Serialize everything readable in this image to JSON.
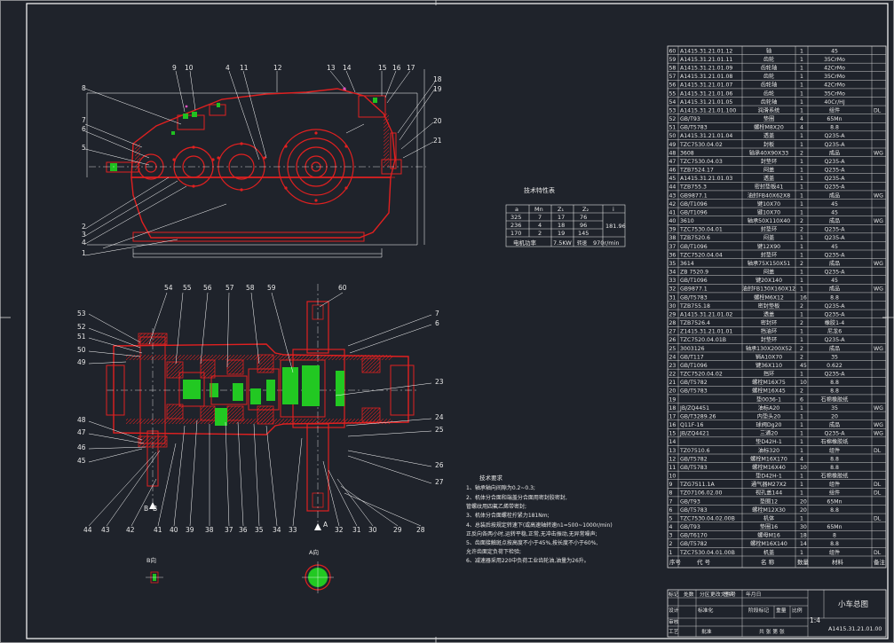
{
  "drawing": {
    "title": "小车总图",
    "number": "A1415.31.21.01.00",
    "scale": "1:4",
    "params_title": "技术特性表",
    "params_headers": [
      "a",
      "Mn",
      "Z₁",
      "Z₂",
      "i"
    ],
    "params_rows": [
      [
        "325",
        "7",
        "17",
        "76"
      ],
      [
        "236",
        "4",
        "18",
        "96"
      ],
      [
        "170",
        "2",
        "19",
        "145"
      ]
    ],
    "params_i": "181.96",
    "motor_power_label": "电机功率",
    "motor_power": "7.5KW",
    "speed_label": "转速",
    "speed": "970r/min",
    "tech_title": "技术要求",
    "tech_notes": [
      "1、轴承轴向间隙为0.2~0.3;",
      "2、机体分合面和端盖分合面用密封胶密封,",
      "   管螺纹用四氟乙烯带密封;",
      "3、机体分合面螺栓拧紧力181Nm;",
      "4、总装后按规定转速下(或高速轴转速n1=500~1000r/min)",
      "   正反向各两小时,运转平稳,正常,无冲击振动,无异常噪声;",
      "5、齿面接触斑点按高度不小于45%,按长度不小于60%,",
      "   允许齿面定负荷下检验;",
      "6、减速器采用220中负荷工业齿轮油,油量为26升。"
    ],
    "view_b": "B向",
    "view_a": "A向",
    "label_a": "A",
    "label_b": "B",
    "top_leaders": [
      "1",
      "2",
      "3",
      "4",
      "5",
      "6",
      "7",
      "8",
      "9",
      "10",
      "4",
      "11",
      "12",
      "13",
      "14",
      "15",
      "16",
      "17",
      "18",
      "19",
      "20",
      "21"
    ],
    "bottom_leaders": [
      "54",
      "55",
      "56",
      "57",
      "58",
      "59",
      "60",
      "53",
      "52",
      "51",
      "50",
      "49",
      "48",
      "47",
      "46",
      "45",
      "7",
      "6",
      "23",
      "24",
      "25",
      "26",
      "27",
      "44",
      "43",
      "42",
      "41",
      "40",
      "39",
      "38",
      "37",
      "36",
      "35",
      "34",
      "33",
      "32",
      "31",
      "30",
      "29",
      "28"
    ]
  },
  "bom": {
    "header": [
      "序号",
      "代 号",
      "名 称",
      "数量",
      "材料",
      "备注"
    ],
    "rows": [
      [
        "60",
        "A1415.31.21.01.12",
        "轴",
        "1",
        "45",
        ""
      ],
      [
        "59",
        "A1415.31.21.01.11",
        "齿轮",
        "1",
        "35CrMo",
        ""
      ],
      [
        "58",
        "A1415.31.21.01.09",
        "齿轮轴",
        "1",
        "42CrMo",
        ""
      ],
      [
        "57",
        "A1415.31.21.01.08",
        "齿轮",
        "1",
        "35CrMo",
        ""
      ],
      [
        "56",
        "A1415.31.21.01.07",
        "齿轮轴",
        "1",
        "42CrMo",
        ""
      ],
      [
        "55",
        "A1415.31.21.01.06",
        "齿轮",
        "1",
        "35CrMo",
        ""
      ],
      [
        "54",
        "A1415.31.21.01.05",
        "齿轮轴",
        "1",
        "40Cr/HJ",
        ""
      ],
      [
        "53",
        "A1415.31.21.01.100",
        "润滑系统",
        "1",
        "组件",
        "DL"
      ],
      [
        "52",
        "GB/T93",
        "垫圈",
        "4",
        "65Mn",
        ""
      ],
      [
        "51",
        "GB/T5783",
        "螺栓M8X20",
        "4",
        "8.8",
        ""
      ],
      [
        "50",
        "A1415.31.21.01.04",
        "透盖",
        "1",
        "Q235-A",
        ""
      ],
      [
        "49",
        "TZC7530.04.02",
        "封板",
        "1",
        "Q235-A",
        ""
      ],
      [
        "48",
        "3608",
        "轴承40X90X33",
        "2",
        "成品",
        "WG"
      ],
      [
        "47",
        "TZC7530.04.03",
        "封垫环",
        "1",
        "Q235-A",
        ""
      ],
      [
        "46",
        "TZB7524.17",
        "闷盖",
        "1",
        "Q235-A",
        ""
      ],
      [
        "45",
        "A1415.31.21.01.03",
        "透盖",
        "1",
        "Q235-A",
        ""
      ],
      [
        "44",
        "TZB755.3",
        "密封垫板41",
        "1",
        "Q235-A",
        ""
      ],
      [
        "43",
        "GB9877.1",
        "油封FB40X62X8",
        "1",
        "成品",
        "WG"
      ],
      [
        "42",
        "GB/T1096",
        "键10X70",
        "1",
        "45",
        ""
      ],
      [
        "41",
        "GB/T1096",
        "键10X70",
        "1",
        "45",
        ""
      ],
      [
        "40",
        "3610",
        "轴承50X110X40",
        "2",
        "成品",
        "WG"
      ],
      [
        "39",
        "TZC7530.04.01",
        "封垫环",
        "2",
        "Q235-A",
        ""
      ],
      [
        "38",
        "TZB7520.6",
        "闷盖",
        "1",
        "Q235-A",
        ""
      ],
      [
        "37",
        "GB/T1096",
        "键12X90",
        "1",
        "45",
        ""
      ],
      [
        "36",
        "TZC7520.04.04",
        "封垫环",
        "1",
        "Q235-A",
        ""
      ],
      [
        "35",
        "3614",
        "轴承75X150X51",
        "2",
        "成品",
        "WG"
      ],
      [
        "34",
        "ZB 7520.9",
        "闷盖",
        "1",
        "Q235-A",
        ""
      ],
      [
        "33",
        "GB/T1096",
        "键20X140",
        "1",
        "45",
        ""
      ],
      [
        "32",
        "GB9877.1",
        "油封FB130X160X12",
        "1",
        "成品",
        "WG"
      ],
      [
        "31",
        "GB/T5783",
        "螺栓M6X12",
        "16",
        "8.8",
        ""
      ],
      [
        "30",
        "TZB755.18",
        "密封垫板",
        "2",
        "Q235-A",
        ""
      ],
      [
        "29",
        "A1415.31.21.01.02",
        "透盖",
        "1",
        "Q235-A",
        ""
      ],
      [
        "28",
        "TZB7526.4",
        "密封环",
        "2",
        "橡胶1-4",
        ""
      ],
      [
        "27",
        "Z1415.31.21.01.01",
        "挡油环",
        "1",
        "尼龙6",
        ""
      ],
      [
        "26",
        "TZC7520.04.01B",
        "封垫环",
        "1",
        "Q235-A",
        ""
      ],
      [
        "25",
        "3003126",
        "轴承130X200X52",
        "2",
        "成品",
        "WG"
      ],
      [
        "24",
        "GB/T117",
        "销A10X70",
        "2",
        "35",
        ""
      ],
      [
        "23",
        "GB/T1096",
        "键36X110",
        "45",
        "0.622",
        ""
      ],
      [
        "22",
        "TZC7520.04.02",
        "挡环",
        "1",
        "Q235-A",
        ""
      ],
      [
        "21",
        "GB/T5782",
        "螺栓M16X75",
        "10",
        "8.8",
        ""
      ],
      [
        "20",
        "GB/T5783",
        "螺栓M16X45",
        "2",
        "8.8",
        ""
      ],
      [
        "19",
        "",
        "垫0036-1",
        "6",
        "石棉橡胶纸",
        ""
      ],
      [
        "18",
        "JB/ZQ4451",
        "油标A20",
        "1",
        "35",
        "WG"
      ],
      [
        "17",
        "GB/T3289.26",
        "内垫头20",
        "1",
        "20",
        ""
      ],
      [
        "16",
        "Q11F-16",
        "球阀Dg20",
        "1",
        "成品",
        "WG"
      ],
      [
        "15",
        "JB/ZQ4421",
        "三通20",
        "1",
        "Q235-A",
        "WG"
      ],
      [
        "14",
        "",
        "垫D42H-1",
        "1",
        "石棉橡胶纸",
        ""
      ],
      [
        "13",
        "TZ07510.6",
        "油标320",
        "1",
        "组件",
        "DL"
      ],
      [
        "12",
        "GB/T5782",
        "螺栓M16X170",
        "4",
        "8.8",
        ""
      ],
      [
        "11",
        "GB/T5783",
        "螺栓M16X40",
        "10",
        "8.8",
        ""
      ],
      [
        "10",
        "",
        "垫D42H-1",
        "1",
        "石棉橡胶纸",
        ""
      ],
      [
        "9",
        "TZG7511.1A",
        "通气器M27X2",
        "1",
        "组件",
        "DL"
      ],
      [
        "8",
        "TZ07106.02.00",
        "视孔盖144",
        "1",
        "组件",
        "DL"
      ],
      [
        "7",
        "GB/T93",
        "垫圈12",
        "20",
        "65Mn",
        ""
      ],
      [
        "6",
        "GB/T5783",
        "螺栓M12X30",
        "20",
        "8.8",
        ""
      ],
      [
        "5",
        "TZC7530.04.02.00B",
        "机体",
        "1",
        "",
        "DL"
      ],
      [
        "4",
        "GB/T93",
        "垫圈16",
        "30",
        "65Mn",
        ""
      ],
      [
        "3",
        "GB/T6170",
        "螺母M16",
        "18",
        "8",
        ""
      ],
      [
        "2",
        "GB/T5782",
        "螺栓M16X140",
        "14",
        "8.8",
        ""
      ],
      [
        "1",
        "TZC7530.04.01.00B",
        "机盖",
        "1",
        "组件",
        "DL"
      ]
    ]
  },
  "title_block": {
    "left_rows": [
      "标记",
      "处数",
      "分区",
      "更改文件号",
      "签名",
      "年月日"
    ],
    "design": "设计",
    "standard": "标准化",
    "review": "审核",
    "craft": "工艺",
    "approve": "批准",
    "stage_mark": "阶段标记",
    "weight": "重量",
    "ratio": "比例",
    "sheets": "共  张  第  张"
  }
}
